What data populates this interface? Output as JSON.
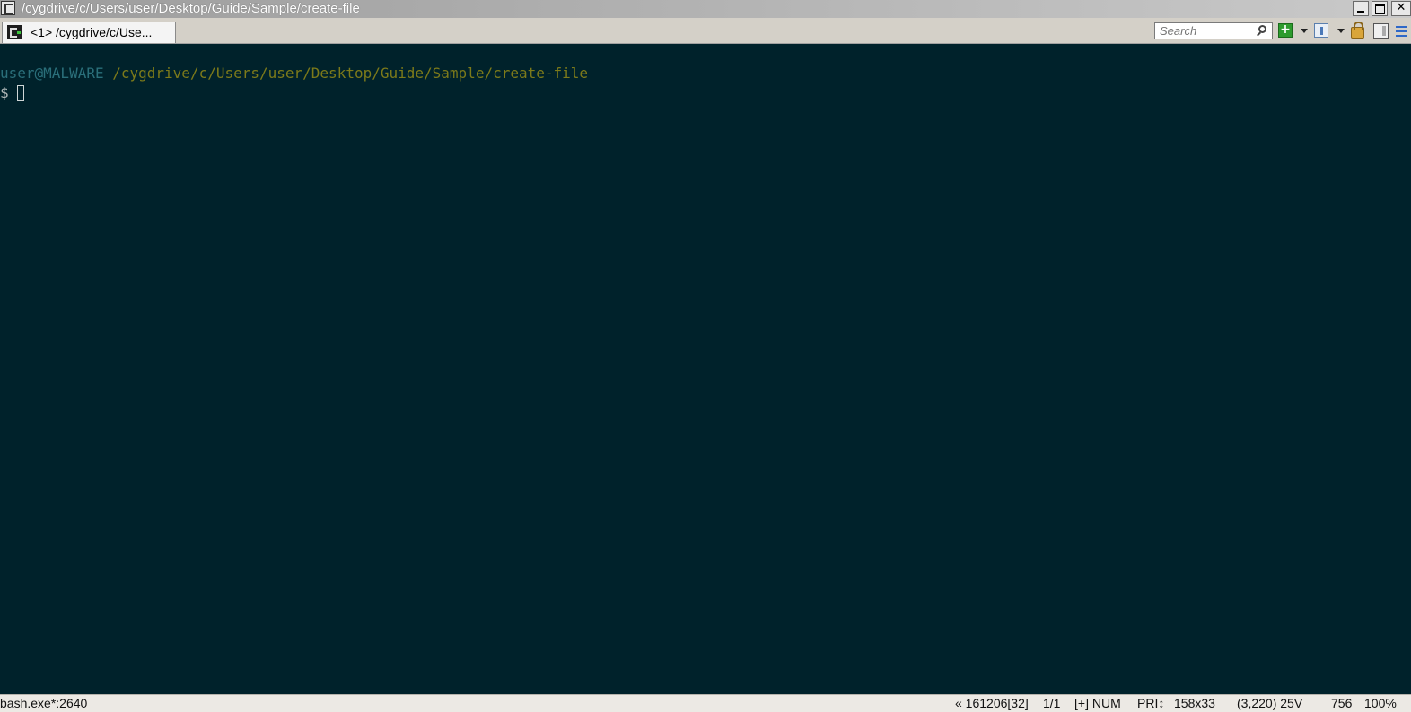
{
  "window": {
    "title": "/cygdrive/c/Users/user/Desktop/Guide/Sample/create-file"
  },
  "tabs": [
    {
      "label": "<1> /cygdrive/c/Use..."
    }
  ],
  "toolbar": {
    "search_placeholder": "Search"
  },
  "terminal": {
    "prompt_user_host": "user@MALWARE",
    "prompt_path": "/cygdrive/c/Users/user/Desktop/Guide/Sample/create-file",
    "prompt_symbol": "$ ",
    "colors": {
      "background": "#00222b",
      "user_host": "#2a6f7a",
      "path": "#7c7a1a"
    }
  },
  "statusbar": {
    "process": "bash.exe*:2640",
    "pid_info": "« 161206[32]",
    "console_index": "1/1",
    "flags": "[+] NUM",
    "priority": "PRI↕",
    "size": "158x33",
    "cursor": "(3,220) 25V",
    "number": "756",
    "zoom": "100%"
  }
}
